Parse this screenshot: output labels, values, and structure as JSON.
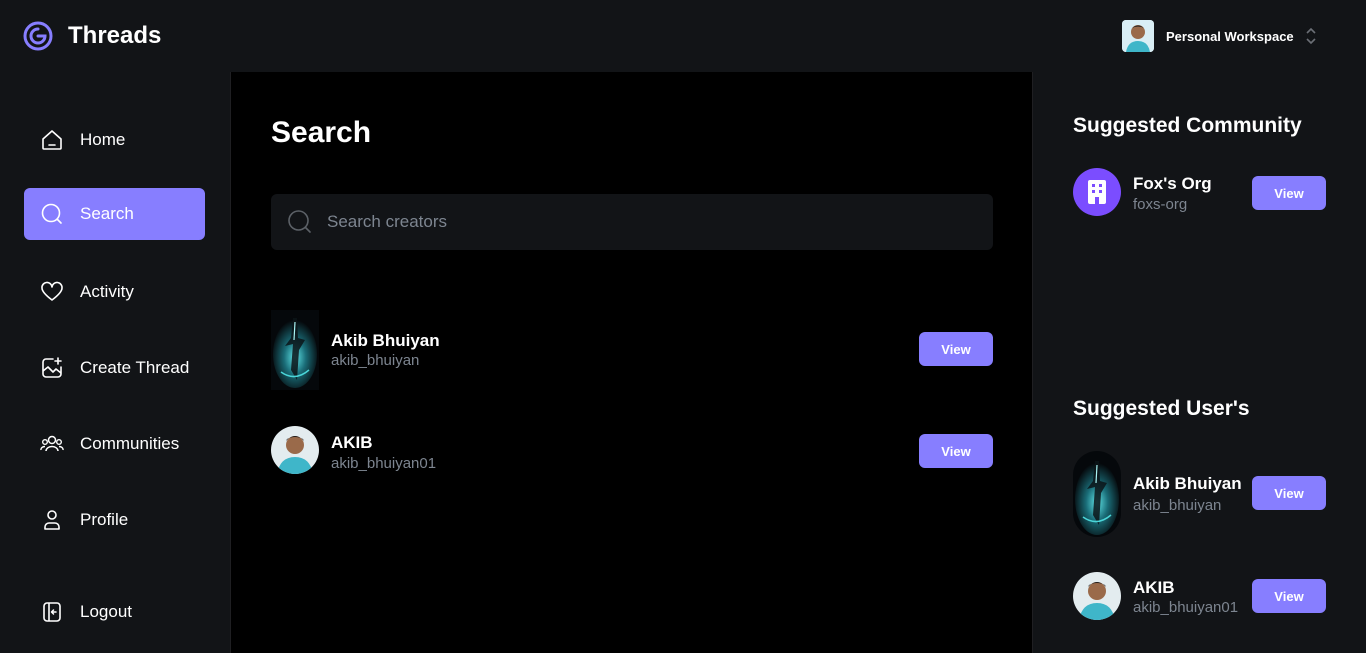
{
  "app": {
    "name": "Threads"
  },
  "workspace": {
    "label": "Personal Workspace"
  },
  "sidebar": {
    "items": [
      {
        "label": "Home",
        "icon": "home-icon"
      },
      {
        "label": "Search",
        "icon": "search-icon",
        "active": true
      },
      {
        "label": "Activity",
        "icon": "heart-icon"
      },
      {
        "label": "Create Thread",
        "icon": "create-thread-icon"
      },
      {
        "label": "Communities",
        "icon": "users-icon"
      },
      {
        "label": "Profile",
        "icon": "user-icon"
      }
    ],
    "logout": {
      "label": "Logout",
      "icon": "logout-icon"
    }
  },
  "main": {
    "title": "Search",
    "search": {
      "placeholder": "Search creators",
      "value": ""
    },
    "results": [
      {
        "name": "Akib Bhuiyan",
        "handle": "akib_bhuiyan",
        "avatar": "dark-art-avatar",
        "button": "View"
      },
      {
        "name": "AKIB",
        "handle": "akib_bhuiyan01",
        "avatar": "photo-avatar",
        "button": "View"
      }
    ]
  },
  "rightbar": {
    "communities_title": "Suggested Community",
    "communities": [
      {
        "name": "Fox's Org",
        "handle": "foxs-org",
        "avatar": "building-icon",
        "button": "View"
      }
    ],
    "users_title": "Suggested User's",
    "users": [
      {
        "name": "Akib Bhuiyan",
        "handle": "akib_bhuiyan",
        "avatar": "dark-art-avatar",
        "button": "View"
      },
      {
        "name": "AKIB",
        "handle": "akib_bhuiyan01",
        "avatar": "photo-avatar",
        "button": "View"
      }
    ]
  },
  "colors": {
    "accent": "#877eff",
    "background": "#121417",
    "main_bg": "#000000",
    "muted_text": "#7d8590"
  }
}
